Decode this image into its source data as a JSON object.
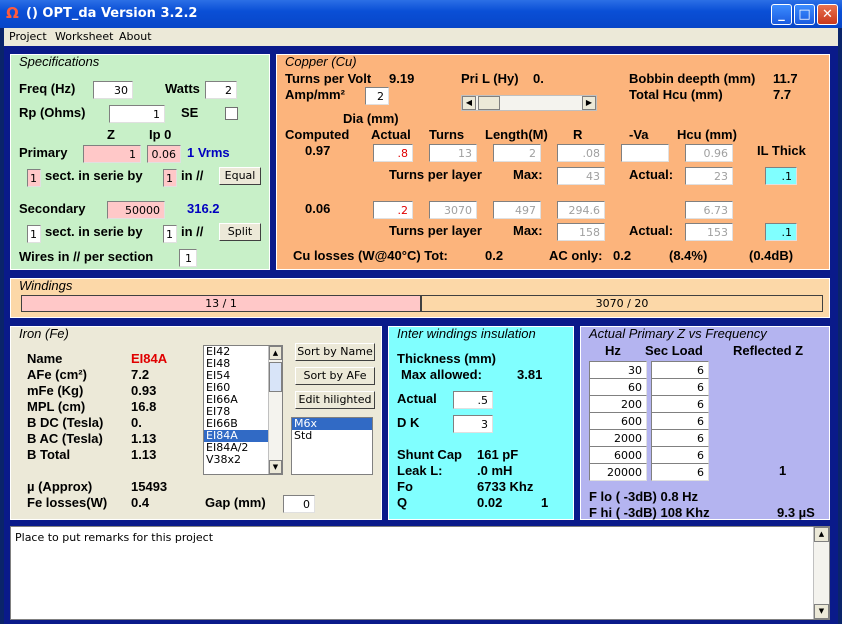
{
  "window": {
    "title": "()  OPT_da Version 3.2.2",
    "icon": "Ω"
  },
  "menu": [
    "Project",
    "Worksheet",
    "About"
  ],
  "spec": {
    "title": "Specifications",
    "freq_label": "Freq (Hz)",
    "freq": "30",
    "watts_label": "Watts",
    "watts": "2",
    "rp_label": "Rp (Ohms)",
    "rp": "1",
    "se_label": "SE",
    "z_label": "Z",
    "ip0_label": "Ip 0",
    "primary_label": "Primary",
    "primary_z": "1",
    "primary_ip": "0.06",
    "vrms": "1 Vrms",
    "sect1": "1",
    "sect_text": "sect. in serie by",
    "par1": "1",
    "in_par": "in //",
    "equal": "Equal",
    "secondary_label": "Secondary",
    "secondary_z": "50000",
    "secondary_v": "316.2",
    "sect2": "1",
    "par2": "1",
    "split": "Split",
    "wires_label": "Wires in // per section",
    "wires": "1"
  },
  "copper": {
    "title": "Copper (Cu)",
    "tpv_label": "Turns per Volt",
    "tpv": "9.19",
    "pril_label": "Pri L (Hy)",
    "pril": "0.",
    "bobbin_label": "Bobbin deepth (mm)",
    "bobbin": "11.7",
    "amp_label": "Amp/mm²",
    "amp": "2",
    "hcu_total_label": "Total Hcu (mm)",
    "hcu_total": "7.7",
    "dia_label": "Dia (mm)",
    "computed_label": "Computed",
    "actual_label": "Actual",
    "turns_label": "Turns",
    "length_label": "Length(M)",
    "r_label": "R",
    "va_label": "-Va",
    "hcu_label": "Hcu (mm)",
    "il_label": "IL Thick",
    "row1": {
      "computed": "0.97",
      "actual": ".8",
      "turns": "13",
      "length": "2",
      "r": ".08",
      "va": "",
      "hcu": "0.96",
      "max": "43",
      "act": "23",
      "il": ".1"
    },
    "row2": {
      "computed": "0.06",
      "actual": ".2",
      "turns": "3070",
      "length": "497",
      "r": "294.6",
      "hcu": "6.73",
      "max": "158",
      "act": "153",
      "il": ".1"
    },
    "tpl_label": "Turns per layer",
    "max_label": "Max:",
    "act_label": "Actual:",
    "losses_label": "Cu losses (W@40°C) Tot:",
    "losses_tot": "0.2",
    "ac_label": "AC only:",
    "ac": "0.2",
    "pct": "(8.4%)",
    "db": "(0.4dB)"
  },
  "windings": {
    "title": "Windings",
    "primary": "13 / 1",
    "secondary": "3070 / 20"
  },
  "iron": {
    "title": "Iron (Fe)",
    "name_label": "Name",
    "name": "EI84A",
    "afe_label": "AFe (cm²)",
    "afe": "7.2",
    "mfe_label": "mFe (Kg)",
    "mfe": "0.93",
    "mpl_label": "MPL (cm)",
    "mpl": "16.8",
    "bdc_label": "B DC (Tesla)",
    "bdc": "0.",
    "bac_label": "B AC (Tesla)",
    "bac": "1.13",
    "btot_label": "B Total",
    "btot": "1.13",
    "mu_label": "µ (Approx)",
    "mu": "15493",
    "fel_label": "Fe losses(W)",
    "fel": "0.4",
    "gap_label": "Gap (mm)",
    "gap": "0",
    "cores": [
      "EI42",
      "EI48",
      "EI54",
      "EI60",
      "EI66A",
      "EI78",
      "EI66B",
      "EI84A",
      "EI84A/2",
      "V38x2"
    ],
    "selected_core": "EI84A",
    "sort_name": "Sort by Name",
    "sort_afe": "Sort by AFe",
    "edit": "Edit hilighted",
    "materials": [
      "M6x",
      "Std"
    ],
    "selected_material": "M6x"
  },
  "insulation": {
    "title": "Inter windings insulation",
    "thick_label": "Thickness (mm)",
    "maxallow_label": "Max allowed:",
    "maxallow": "3.81",
    "actual_label": "Actual",
    "actual": ".5",
    "dk_label": "D K",
    "dk": "3",
    "shunt_label": "Shunt Cap",
    "shunt": "161 pF",
    "leak_label": "Leak L:",
    "leak": ".0 mH",
    "fo_label": "Fo",
    "fo": "6733 Khz",
    "q_label": "Q",
    "q": "0.02",
    "q2": "1"
  },
  "freq": {
    "title": "Actual Primary Z vs Frequency",
    "hz_label": "Hz",
    "sec_label": "Sec Load",
    "refl_label": "Reflected Z",
    "rows": [
      {
        "hz": "30",
        "load": "6"
      },
      {
        "hz": "60",
        "load": "6"
      },
      {
        "hz": "200",
        "load": "6"
      },
      {
        "hz": "600",
        "load": "6"
      },
      {
        "hz": "2000",
        "load": "6"
      },
      {
        "hz": "6000",
        "load": "6"
      },
      {
        "hz": "20000",
        "load": "6"
      }
    ],
    "refl": "1",
    "flo": "F lo ( -3dB) 0.8 Hz",
    "fhi": "F hi ( -3dB) 108 Khz",
    "us": "9.3 µS"
  },
  "remarks": "Place to put remarks for this project",
  "colors": {
    "green": "#c8f0c8",
    "orange": "#fcb47c",
    "peach": "#fcd8a8",
    "gray": "#ece9d8",
    "cyan": "#80ffff",
    "lavender": "#b4b4f0"
  }
}
